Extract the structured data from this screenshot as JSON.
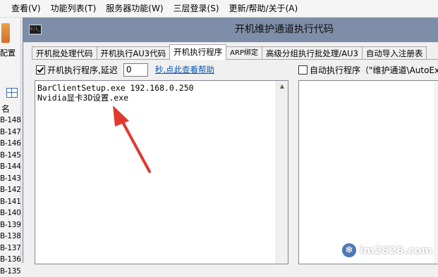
{
  "menu": {
    "items": [
      "查看(V)",
      "功能列表(T)",
      "服务器功能(W)",
      "三层登录(S)",
      "更新/帮助/关于(A)"
    ]
  },
  "left_panel": {
    "toolbar_label": "配置",
    "column_header": "名",
    "rows": [
      "B-148",
      "B-147",
      "B-146",
      "B-145",
      "B-144",
      "B-143",
      "B-142",
      "B-141",
      "B-140",
      "B-139",
      "B-138",
      "B-137",
      "B-136",
      "B-135"
    ]
  },
  "dialog": {
    "title": "开机维护通道执行代码",
    "icon": "cmd-icon",
    "tabs": [
      {
        "label": "开机批处理代码"
      },
      {
        "label": "开机执行AU3代码"
      },
      {
        "label": "开机执行程序"
      },
      {
        "label": "ARP绑定"
      },
      {
        "label": "高级分组执行批处理/AU3"
      },
      {
        "label": "自动导入注册表"
      }
    ],
    "active_tab": "开机执行程序",
    "run_program_checkbox": {
      "label": "开机执行程序,延迟",
      "checked": true
    },
    "delay_value": "0",
    "delay_suffix": "秒,点此查看帮助",
    "auto_run_checkbox": {
      "label": "自动执行程序（\"维护通道\\AutoExe",
      "checked": false
    },
    "code_lines": [
      "BarClientSetup.exe 192.168.0.250",
      "Nvidia显卡3D设置.exe"
    ]
  },
  "watermark": {
    "text": "im2828.com",
    "icon": "snowflake-icon"
  },
  "colors": {
    "titlebar": "#7e8ea8",
    "arrow": "#e03a2e",
    "link": "#0b56b2"
  }
}
